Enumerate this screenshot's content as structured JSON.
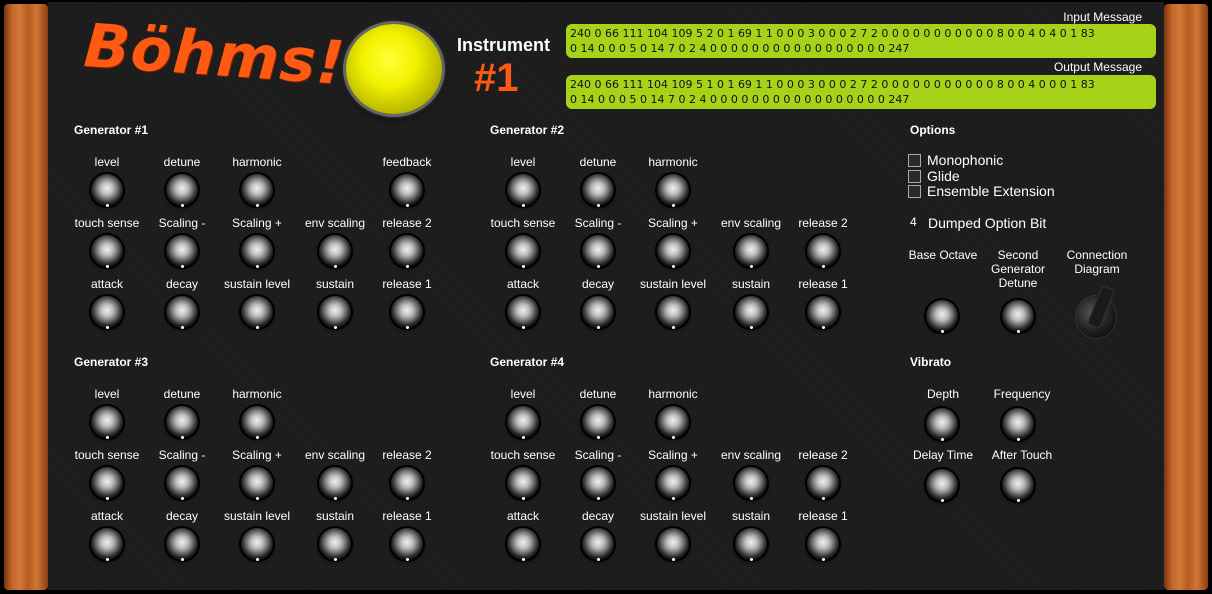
{
  "brand": {
    "logo": "Böhms!"
  },
  "instrument": {
    "label": "Instrument",
    "number": "#1"
  },
  "messages": {
    "input_label": "Input Message",
    "input_line1": "240 0 66 111 104 109 5 2 0 1 69 1 1 0 0 0 3 0 0 0 2 7 2 0 0 0 0 0 0 0 0 0 0 0 8 0 0 4 0 4 0 1 83",
    "input_line2": "0 14 0 0 0 5 0 14 7 0 2 4 0 0 0 0 0 0 0 0 0 0 0 0 0 0 0 0 0 247",
    "output_label": "Output Message",
    "output_line1": "240 0 66 111 104 109 5 1 0 1 69 1 1 0 0 0 3 0 0 0 2 7 2 0 0 0 0 0 0 0 0 0 0 0 8 0 0 4 0 0 0 1 83",
    "output_line2": "0 14 0 0 0 5 0 14 7 0 2 4 0 0 0 0 0 0 0 0 0 0 0 0 0 0 0 0 0 247"
  },
  "generators": {
    "g1": {
      "title": "Generator #1"
    },
    "g2": {
      "title": "Generator #2"
    },
    "g3": {
      "title": "Generator #3"
    },
    "g4": {
      "title": "Generator #4"
    }
  },
  "knob_labels": {
    "level": "level",
    "detune": "detune",
    "harmonic": "harmonic",
    "feedback": "feedback",
    "touch_sense": "touch sense",
    "scaling_minus": "Scaling -",
    "scaling_plus": "Scaling +",
    "env_scaling": "env scaling",
    "release2": "release 2",
    "attack": "attack",
    "decay": "decay",
    "sustain_level": "sustain level",
    "sustain": "sustain",
    "release1": "release 1"
  },
  "options": {
    "title": "Options",
    "monophonic": "Monophonic",
    "glide": "Glide",
    "ensemble": "Ensemble Extension",
    "dumped_value": "4",
    "dumped_label": "Dumped Option Bit",
    "base_octave": "Base Octave",
    "second_detune": "Second Generator Detune",
    "connection": "Connection Diagram"
  },
  "vibrato": {
    "title": "Vibrato",
    "depth": "Depth",
    "frequency": "Frequency",
    "delay_time": "Delay Time",
    "after_touch": "After Touch"
  },
  "colors": {
    "accent": "#ff5a14",
    "button": "#f2f200",
    "message_bg": "#a6d21a"
  }
}
